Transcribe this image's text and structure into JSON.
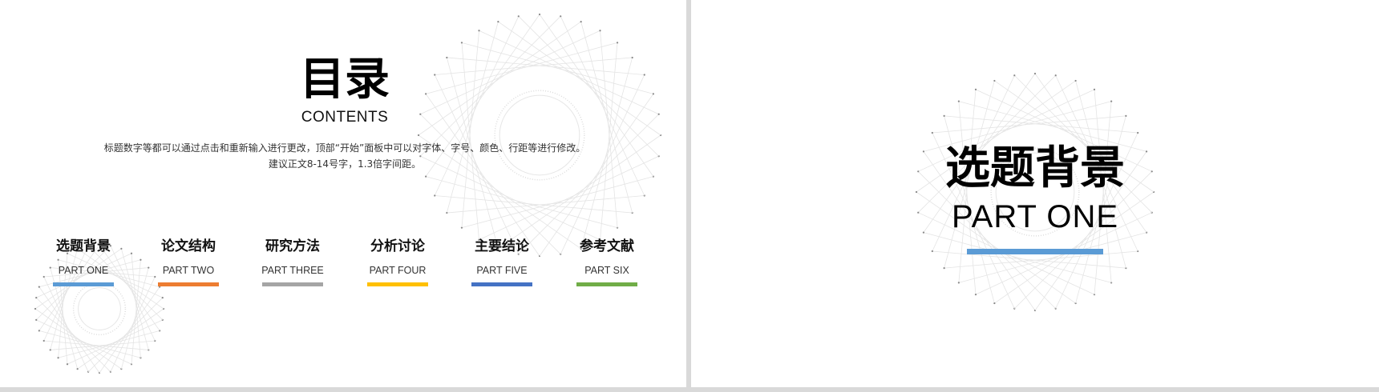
{
  "slide1": {
    "title": "目录",
    "subtitle": "CONTENTS",
    "description_line1": "标题数字等都可以通过点击和重新输入进行更改，顶部“开始”面板中可以对字体、字号、颜色、行距等进行修改。",
    "description_line2": "建议正文8-14号字，1.3倍字间距。",
    "parts": [
      {
        "title": "选题背景",
        "subtitle": "PART ONE",
        "color": "#5b9bd5"
      },
      {
        "title": "论文结构",
        "subtitle": "PART TWO",
        "color": "#ed7d31"
      },
      {
        "title": "研究方法",
        "subtitle": "PART THREE",
        "color": "#a5a5a5"
      },
      {
        "title": "分析讨论",
        "subtitle": "PART FOUR",
        "color": "#ffc000"
      },
      {
        "title": "主要结论",
        "subtitle": "PART FIVE",
        "color": "#4472c4"
      },
      {
        "title": "参考文献",
        "subtitle": "PART SIX",
        "color": "#70ad47"
      }
    ]
  },
  "slide2": {
    "title": "选题背景",
    "subtitle": "PART ONE",
    "bar_color": "#5b9bd5"
  }
}
